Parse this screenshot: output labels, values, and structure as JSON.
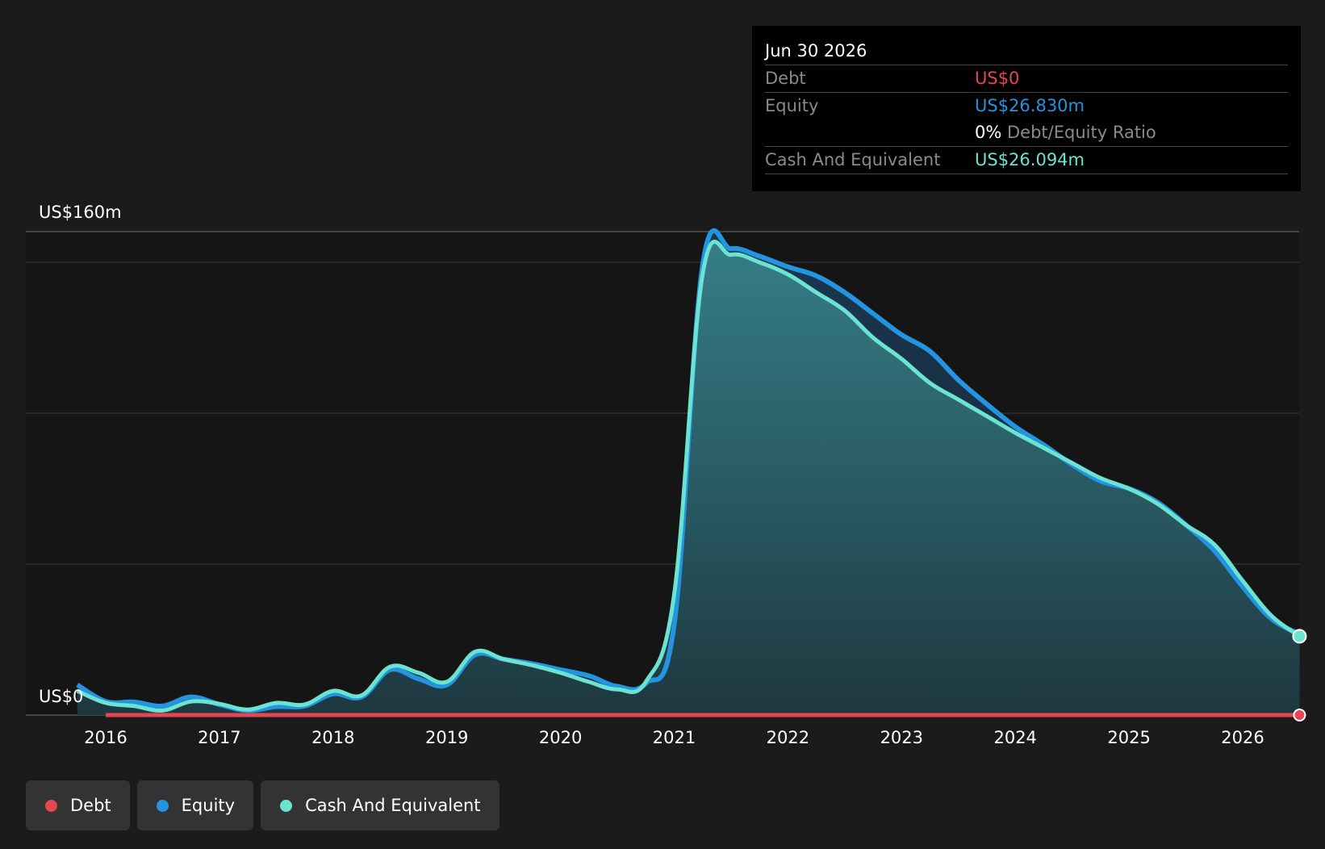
{
  "tooltip": {
    "date": "Jun 30 2026",
    "debt_label": "Debt",
    "debt_value": "US$0",
    "equity_label": "Equity",
    "equity_value": "US$26.830m",
    "ratio_pct": "0%",
    "ratio_label": "Debt/Equity Ratio",
    "cash_label": "Cash And Equivalent",
    "cash_value": "US$26.094m"
  },
  "colors": {
    "debt": "#e64552",
    "equity": "#2394df",
    "cash": "#6be3d0",
    "background": "#1b1b1b",
    "plot_background": "#151515"
  },
  "legend": [
    {
      "label": "Debt",
      "color": "#e64552"
    },
    {
      "label": "Equity",
      "color": "#2394df"
    },
    {
      "label": "Cash And Equivalent",
      "color": "#6be3d0"
    }
  ],
  "chart_data": {
    "type": "area",
    "title": "",
    "xlabel": "",
    "ylabel": "",
    "y_top_label": "US$160m",
    "y_bottom_label": "US$0",
    "ylim": [
      0,
      160
    ],
    "xlim": [
      2015.5,
      2026.5
    ],
    "x_ticks": [
      "2016",
      "2017",
      "2018",
      "2019",
      "2020",
      "2021",
      "2022",
      "2023",
      "2024",
      "2025",
      "2026"
    ],
    "grid": true,
    "legend_position": "bottom-left",
    "series": [
      {
        "name": "Debt",
        "points": [
          [
            2016.0,
            0
          ],
          [
            2026.5,
            0
          ]
        ]
      },
      {
        "name": "Equity",
        "points": [
          [
            2015.75,
            10
          ],
          [
            2016.0,
            4.5
          ],
          [
            2016.25,
            4.3
          ],
          [
            2016.5,
            3
          ],
          [
            2016.75,
            6
          ],
          [
            2017.0,
            3.5
          ],
          [
            2017.25,
            1.5
          ],
          [
            2017.5,
            2.8
          ],
          [
            2017.75,
            3
          ],
          [
            2018.0,
            7
          ],
          [
            2018.25,
            6
          ],
          [
            2018.5,
            15
          ],
          [
            2018.75,
            12
          ],
          [
            2019.0,
            10
          ],
          [
            2019.25,
            20
          ],
          [
            2019.5,
            18.5
          ],
          [
            2019.75,
            17
          ],
          [
            2020.0,
            15
          ],
          [
            2020.25,
            13
          ],
          [
            2020.5,
            9.5
          ],
          [
            2020.75,
            10.5
          ],
          [
            2021.0,
            30
          ],
          [
            2021.25,
            149
          ],
          [
            2021.5,
            154.5
          ],
          [
            2021.75,
            152
          ],
          [
            2022.0,
            148.5
          ],
          [
            2022.25,
            145.5
          ],
          [
            2022.5,
            140
          ],
          [
            2022.75,
            133
          ],
          [
            2023.0,
            126
          ],
          [
            2023.25,
            120.5
          ],
          [
            2023.5,
            111
          ],
          [
            2023.75,
            103
          ],
          [
            2024.0,
            95.5
          ],
          [
            2024.25,
            89.5
          ],
          [
            2024.5,
            83
          ],
          [
            2024.75,
            77.5
          ],
          [
            2025.0,
            75
          ],
          [
            2025.25,
            70.5
          ],
          [
            2025.5,
            63
          ],
          [
            2025.75,
            54.5
          ],
          [
            2026.0,
            42.5
          ],
          [
            2026.25,
            32
          ],
          [
            2026.5,
            26.83
          ]
        ]
      },
      {
        "name": "Cash And Equivalent",
        "points": [
          [
            2015.75,
            8
          ],
          [
            2016.0,
            4
          ],
          [
            2016.25,
            3
          ],
          [
            2016.5,
            1.5
          ],
          [
            2016.75,
            4.5
          ],
          [
            2017.0,
            3.7
          ],
          [
            2017.25,
            1.8
          ],
          [
            2017.5,
            4
          ],
          [
            2017.75,
            3.5
          ],
          [
            2018.0,
            8
          ],
          [
            2018.25,
            6.5
          ],
          [
            2018.5,
            16
          ],
          [
            2018.75,
            14
          ],
          [
            2019.0,
            11
          ],
          [
            2019.25,
            21
          ],
          [
            2019.5,
            18.5
          ],
          [
            2019.75,
            16.5
          ],
          [
            2020.0,
            14
          ],
          [
            2020.25,
            11
          ],
          [
            2020.5,
            8.5
          ],
          [
            2020.75,
            11
          ],
          [
            2021.0,
            40
          ],
          [
            2021.25,
            146
          ],
          [
            2021.5,
            152.5
          ],
          [
            2021.75,
            150
          ],
          [
            2022.0,
            146
          ],
          [
            2022.25,
            140
          ],
          [
            2022.5,
            134
          ],
          [
            2022.75,
            125
          ],
          [
            2023.0,
            118
          ],
          [
            2023.25,
            110
          ],
          [
            2023.5,
            104.5
          ],
          [
            2023.75,
            99
          ],
          [
            2024.0,
            93.5
          ],
          [
            2024.25,
            88.5
          ],
          [
            2024.5,
            83.5
          ],
          [
            2024.75,
            78.5
          ],
          [
            2025.0,
            75
          ],
          [
            2025.25,
            70
          ],
          [
            2025.5,
            63
          ],
          [
            2025.75,
            56.5
          ],
          [
            2026.0,
            44.5
          ],
          [
            2026.25,
            33
          ],
          [
            2026.5,
            26.094
          ]
        ]
      }
    ]
  }
}
